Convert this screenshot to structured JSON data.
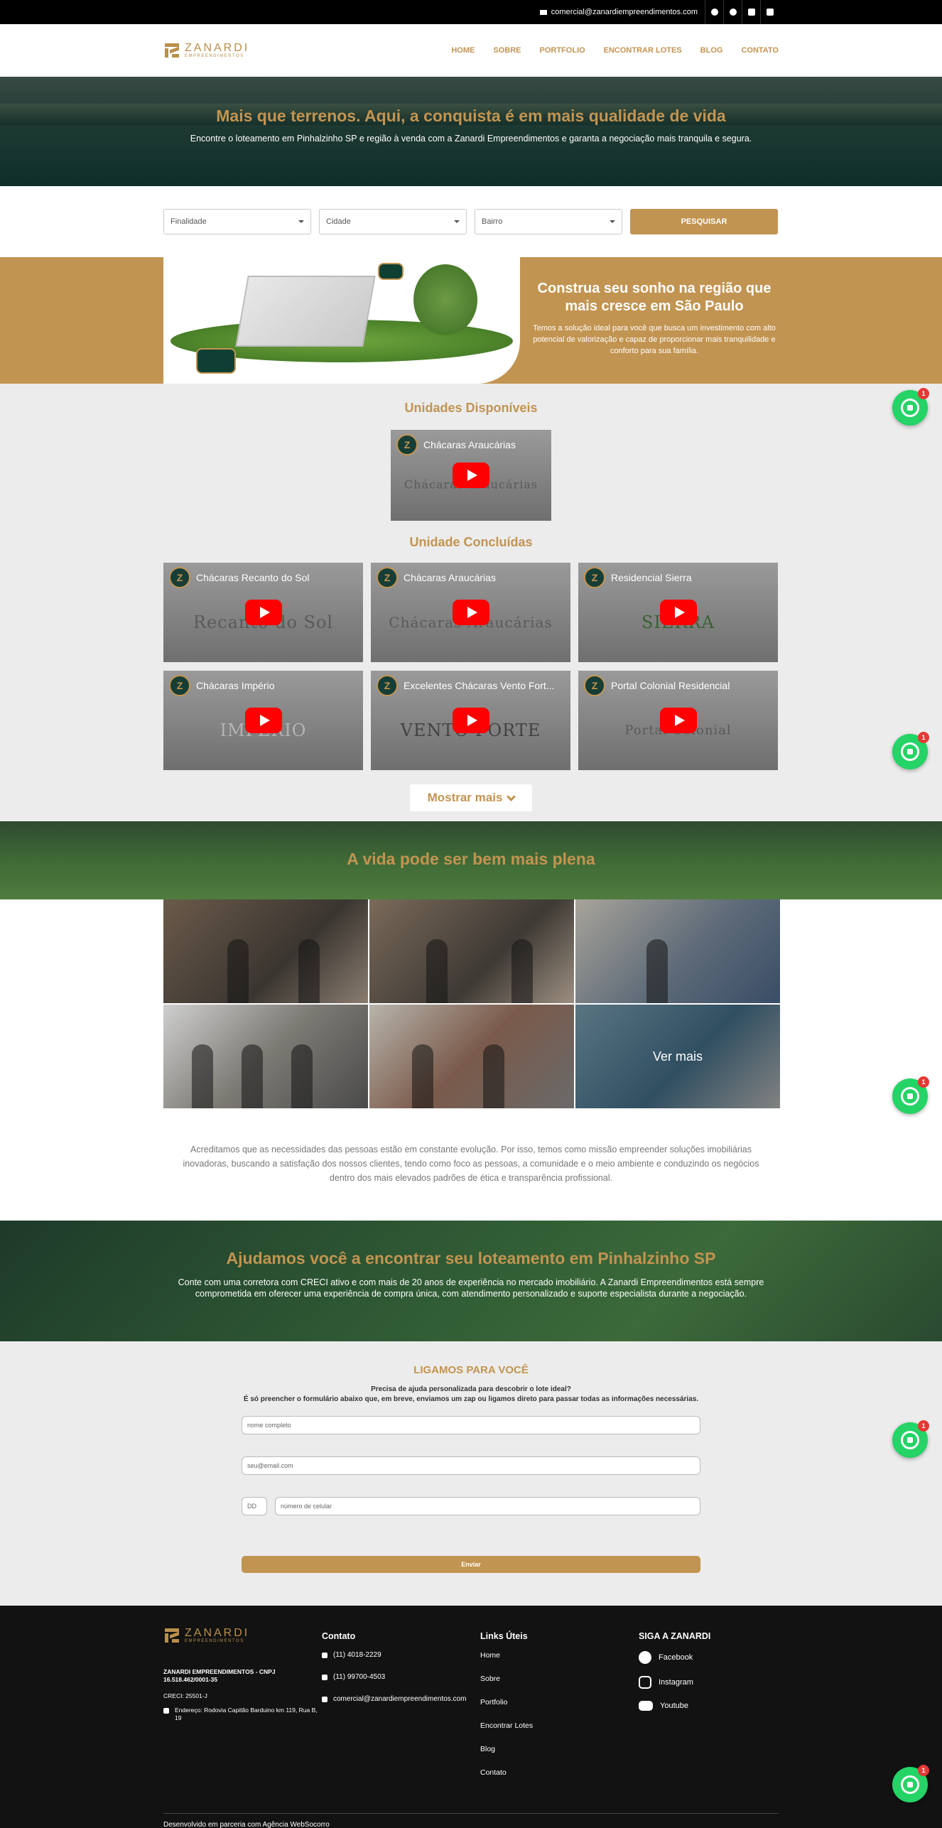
{
  "topbar": {
    "email": "comercial@zanardiempreendimentos.com",
    "social_icons": [
      "facebook-icon",
      "instagram-icon",
      "youtube-icon",
      "linkedin-icon"
    ]
  },
  "header": {
    "logo_name": "ZANARDI",
    "logo_sub": "EMPREENDIMENTOS",
    "nav": [
      "HOME",
      "SOBRE",
      "PORTFOLIO",
      "ENCONTRAR LOTES",
      "BLOG",
      "CONTATO"
    ]
  },
  "hero": {
    "title": "Mais que terrenos. Aqui, a conquista é em mais qualidade de vida",
    "subtitle": "Encontre o loteamento em Pinhalzinho SP e região à venda com a Zanardi Empreendimentos e garanta a negociação mais tranquila e segura."
  },
  "search": {
    "finalidade": "Finalidade",
    "cidade": "Cidade",
    "bairro": "Bairro",
    "button": "PESQUISAR"
  },
  "promo": {
    "title": "Construa seu sonho na região que mais cresce em São Paulo",
    "text": "Temos a solução ideal para você que busca um investimento com alto potencial de valorização e capaz de proporcionar mais tranquilidade e conforto para sua família."
  },
  "available": {
    "title": "Unidades Disponíveis",
    "video": {
      "title": "Chácaras Araucárias",
      "art": "Chácaras Araucárias"
    }
  },
  "completed": {
    "title": "Unidade Concluídas",
    "videos": [
      {
        "title": "Chácaras Recanto do Sol",
        "art": "Recanto do Sol"
      },
      {
        "title": "Chácaras Araucárias",
        "art": "Chácaras Araucárias"
      },
      {
        "title": "Residencial Sierra",
        "art": "SIERRA"
      },
      {
        "title": "Chácaras Império",
        "art": "IMPERIO"
      },
      {
        "title": "Excelentes Chácaras Vento Fort...",
        "art": "VENTO FORTE"
      },
      {
        "title": "Portal Colonial Residencial",
        "art": "Portal Colonial"
      }
    ],
    "more": "Mostrar mais"
  },
  "life": {
    "title": "A vida pode ser bem mais plena"
  },
  "photos": {
    "see_more": "Ver mais"
  },
  "mission": {
    "text": "Acreditamos que as necessidades das pessoas estão em constante evolução. Por isso, temos como missão empreender soluções imobiliárias inovadoras, buscando a satisfação dos nossos clientes, tendo como foco as pessoas, a comunidade e o meio ambiente e conduzindo os negócios dentro dos mais elevados padrões de ética e transparência profissional."
  },
  "help": {
    "title": "Ajudamos você a encontrar seu loteamento em Pinhalzinho SP",
    "text": "Conte com uma corretora com CRECI ativo e com mais de 20 anos de experiência no mercado imobiliário. A Zanardi Empreendimentos está sempre comprometida em oferecer uma experiência de compra única, com atendimento personalizado e suporte especialista durante a negociação."
  },
  "form": {
    "title": "LIGAMOS PARA VOCÊ",
    "line1": "Precisa de ajuda personalizada para descobrir o lote ideal?",
    "line2": "É só preencher o formulário abaixo que, em breve, enviamos um zap ou ligamos direto para passar todas as informações necessárias.",
    "name_placeholder": "nome completo",
    "email_placeholder": "seu@email.com",
    "dd_placeholder": "DD",
    "phone_placeholder": "número de celular",
    "submit": "Enviar"
  },
  "footer": {
    "company": "ZANARDI EMPREENDIMENTOS - CNPJ 16.518.462/0001-35",
    "creci": "CRECI: 25501-J",
    "address": "Endereço: Rodovia Capitão Barduino km 119, Rua B, 19",
    "contact_title": "Contato",
    "phone1": "(11) 4018-2229",
    "phone2": "(11) 99700-4503",
    "email": "comercial@zanardiempreendimentos.com",
    "links_title": "Links Úteis",
    "links": [
      "Home",
      "Sobre",
      "Portfolio",
      "Encontrar Lotes",
      "Blog",
      "Contato"
    ],
    "social_title": "SIGA A ZANARDI",
    "social": [
      "Facebook",
      "Instagram",
      "Youtube"
    ],
    "credit": "Desenvolvido em parceria com Agência WebSocorro"
  },
  "whatsapp": {
    "badge": "1"
  },
  "colors": {
    "gold": "#c29451",
    "dark_green": "#0f2e2a",
    "footer": "#121212",
    "whatsapp": "#25d366"
  }
}
